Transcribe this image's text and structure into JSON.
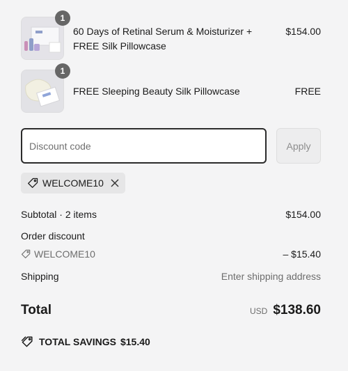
{
  "items": [
    {
      "quantity": "1",
      "title": "60 Days of Retinal Serum & Moisturizer + FREE Silk Pillowcase",
      "price": "$154.00"
    },
    {
      "quantity": "1",
      "title": "FREE Sleeping Beauty Silk Pillowcase",
      "price": "FREE"
    }
  ],
  "discount": {
    "placeholder": "Discount code",
    "value": "",
    "apply_label": "Apply",
    "applied_code": "WELCOME10"
  },
  "summary": {
    "subtotal_label": "Subtotal · 2 items",
    "subtotal_value": "$154.00",
    "order_discount_label": "Order discount",
    "discount_code": "WELCOME10",
    "discount_value": "– $15.40",
    "shipping_label": "Shipping",
    "shipping_value": "Enter shipping address",
    "total_label": "Total",
    "currency": "USD",
    "total_value": "$138.60",
    "savings_label": "TOTAL SAVINGS",
    "savings_value": "$15.40"
  },
  "icons": {
    "tag": "tag-icon",
    "close": "close-icon",
    "savings": "savings-tag-icon"
  },
  "colors": {
    "background": "#f4f4f5",
    "badge": "#666666",
    "input_border": "#2b2b2b",
    "muted_text": "#6d6d6d"
  }
}
